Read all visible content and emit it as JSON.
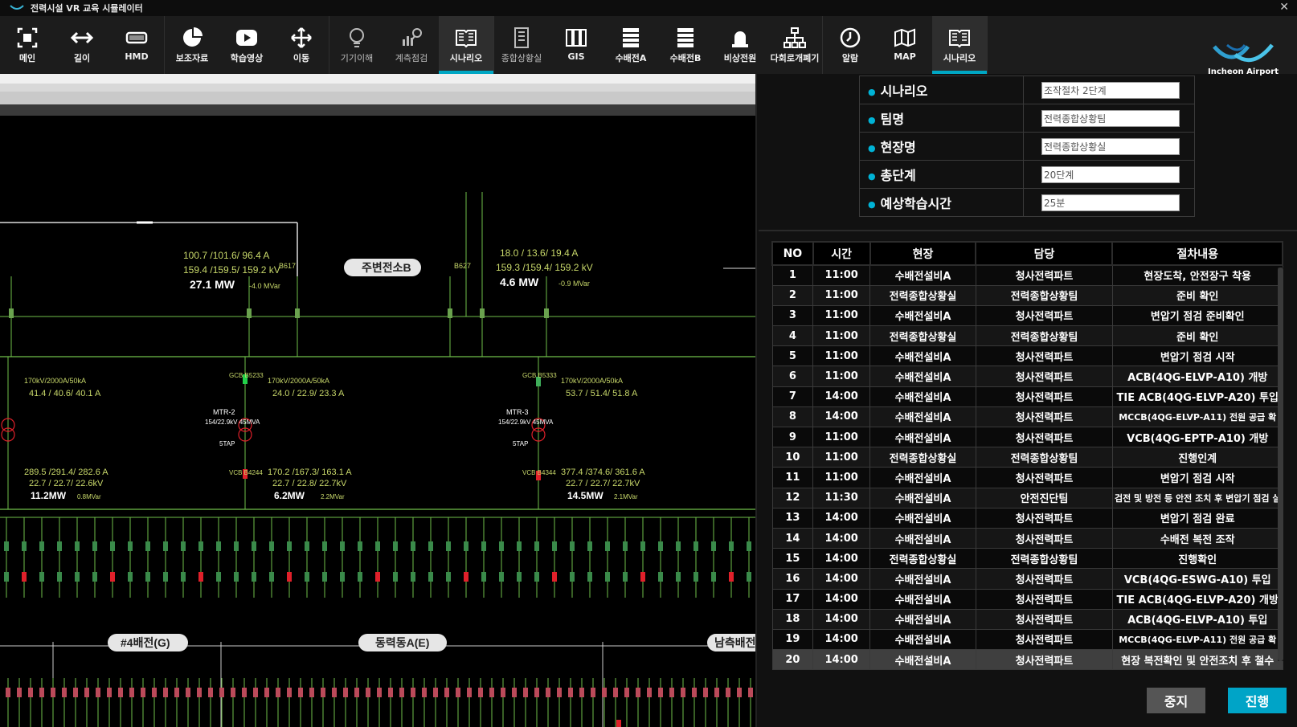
{
  "window": {
    "title": "전력시설 VR 교육 시뮬레이터",
    "close_glyph": "✕"
  },
  "toolbar": {
    "groups": [
      [
        {
          "label": "메인",
          "icon": "expand-icon"
        },
        {
          "label": "길이",
          "icon": "arrows-horizontal-icon"
        },
        {
          "label": "HMD",
          "icon": "vr-headset-icon"
        }
      ],
      [
        {
          "label": "보조자료",
          "icon": "pie-chart-icon"
        },
        {
          "label": "학습영상",
          "icon": "play-video-icon"
        },
        {
          "label": "이동",
          "icon": "move-arrows-icon"
        }
      ],
      [
        {
          "label": "기기이해",
          "icon": "lightbulb-icon"
        },
        {
          "label": "계측점검",
          "icon": "bar-search-icon"
        },
        {
          "label": "시나리오",
          "icon": "book-icon",
          "active": true
        }
      ],
      [
        {
          "label": "종합상황실",
          "icon": "building-icon"
        },
        {
          "label": "GIS",
          "icon": "gis-panels-icon"
        },
        {
          "label": "수배전A",
          "icon": "cabinet-icon"
        },
        {
          "label": "수배전B",
          "icon": "cabinet-icon"
        },
        {
          "label": "비상전원",
          "icon": "alarm-siren-icon"
        },
        {
          "label": "다회로개폐기",
          "icon": "network-tree-icon"
        }
      ],
      [
        {
          "label": "알람",
          "icon": "clock-icon"
        },
        {
          "label": "MAP",
          "icon": "map-icon"
        },
        {
          "label": "시나리오",
          "icon": "book-icon",
          "active": true
        }
      ]
    ],
    "brand": "Incheon Airport"
  },
  "schematic": {
    "bus_labels": [
      "주변전소B",
      "#4배전(G)",
      "동력동A(E)",
      "남측배전("
    ],
    "left_readout": {
      "amps": "100.7 /101.6/  96.4 A",
      "kv": "159.4 /159.5/ 159.2 kV",
      "mw": "27.1 MW",
      "mvar": "-4.0 MVar",
      "breaker": "B617"
    },
    "right_readout": {
      "amps": "18.0 /  13.6/  19.4 A",
      "kv": "159.3 /159.4/ 159.2 kV",
      "mw": "4.6  MW",
      "mvar": "-0.9 MVar",
      "breaker": "B627"
    },
    "tx_left": {
      "rating": "170kV/2000A/50kA",
      "amps": "41.4 /  40.6/  40.1 A",
      "lower_amps": "289.5 /291.4/ 282.6 A",
      "lower_kv": "22.7 /  22.7/  22.6kV",
      "mw": "11.2MW",
      "mvar": "0.8MVar"
    },
    "tx_mid": {
      "rating": "170kV/2000A/50kA",
      "amps": "24.0 /  22.9/  23.3 A",
      "name": "MTR-2",
      "spec": "154/22.9kV 45MVA",
      "tap": "5TAP",
      "gcb": "GCB B5233",
      "vcb": "VCB B4244",
      "lower_amps": "170.2 /167.3/ 163.1 A",
      "lower_kv": "22.7 /  22.8/  22.7kV",
      "mw": "6.2MW",
      "mvar": "2.2MVar"
    },
    "tx_right": {
      "rating": "170kV/2000A/50kA",
      "amps": "53.7 /  51.4/  51.8 A",
      "name": "MTR-3",
      "spec": "154/22.9kV 45MVA",
      "tap": "5TAP",
      "gcb": "GCB B5333",
      "vcb": "VCB B4344",
      "lower_amps": "377.4 /374.6/ 361.6 A",
      "lower_kv": "22.7 /  22.7/  22.7kV",
      "mw": "14.5MW",
      "mvar": "2.1MVar"
    }
  },
  "info": [
    {
      "label": "시나리오",
      "value": "조작절차 2단계"
    },
    {
      "label": "팀명",
      "value": "전력종합상황팀"
    },
    {
      "label": "현장명",
      "value": "전력종합상황실"
    },
    {
      "label": "총단계",
      "value": "20단계"
    },
    {
      "label": "예상학습시간",
      "value": "25분"
    }
  ],
  "table": {
    "headers": [
      "NO",
      "시간",
      "현장",
      "담당",
      "절차내용"
    ],
    "rows": [
      [
        "1",
        "11:00",
        "수배전설비A",
        "청사전력파트",
        "현장도착, 안전장구 착용"
      ],
      [
        "2",
        "11:00",
        "전력종합상황실",
        "전력종합상황팀",
        "준비 확인"
      ],
      [
        "3",
        "11:00",
        "수배전설비A",
        "청사전력파트",
        "변압기 점검 준비확인"
      ],
      [
        "4",
        "11:00",
        "전력종합상황실",
        "전력종합상황팀",
        "준비 확인"
      ],
      [
        "5",
        "11:00",
        "수배전설비A",
        "청사전력파트",
        "변압기 점검 시작"
      ],
      [
        "6",
        "11:00",
        "수배전설비A",
        "청사전력파트",
        "ACB(4QG-ELVP-A10) 개방"
      ],
      [
        "7",
        "14:00",
        "수배전설비A",
        "청사전력파트",
        "TIE ACB(4QG-ELVP-A20) 투입"
      ],
      [
        "8",
        "14:00",
        "수배전설비A",
        "청사전력파트",
        "MCCB(4QG-ELVP-A11) 전원 공급 확"
      ],
      [
        "9",
        "11:00",
        "수배전설비A",
        "청사전력파트",
        "VCB(4QG-EPTP-A10) 개방"
      ],
      [
        "10",
        "11:00",
        "전력종합상황실",
        "전력종합상황팀",
        "진행인계"
      ],
      [
        "11",
        "11:00",
        "수배전설비A",
        "청사전력파트",
        "변압기 점검 시작"
      ],
      [
        "12",
        "11:30",
        "수배전설비A",
        "안전진단팀",
        "검전 및 방전 등 안전 조치 후 변압기 점검 실"
      ],
      [
        "13",
        "14:00",
        "수배전설비A",
        "청사전력파트",
        "변압기 점검 완료"
      ],
      [
        "14",
        "14:00",
        "수배전설비A",
        "청사전력파트",
        "수배전 복전 조작"
      ],
      [
        "15",
        "14:00",
        "전력종합상황실",
        "전력종합상황팀",
        "진행확인"
      ],
      [
        "16",
        "14:00",
        "수배전설비A",
        "청사전력파트",
        "VCB(4QG-ESWG-A10) 투입"
      ],
      [
        "17",
        "14:00",
        "수배전설비A",
        "청사전력파트",
        "TIE ACB(4QG-ELVP-A20) 개방"
      ],
      [
        "18",
        "14:00",
        "수배전설비A",
        "청사전력파트",
        "ACB(4QG-ELVP-A10) 투입"
      ],
      [
        "19",
        "14:00",
        "수배전설비A",
        "청사전력파트",
        "MCCB(4QG-ELVP-A11) 전원 공급 확"
      ],
      [
        "20",
        "14:00",
        "수배전설비A",
        "청사전력파트",
        "현장 복전확인 및 안전조치 후 철수"
      ]
    ],
    "selected_row": 20
  },
  "buttons": {
    "stop": "중지",
    "proceed": "진행"
  },
  "colors": {
    "accent": "#00a7c4",
    "bus_line": "#6fbf4a",
    "breaker_closed": "#e0202a",
    "breaker_open": "#22d14a",
    "readout": "#c8d86a"
  }
}
